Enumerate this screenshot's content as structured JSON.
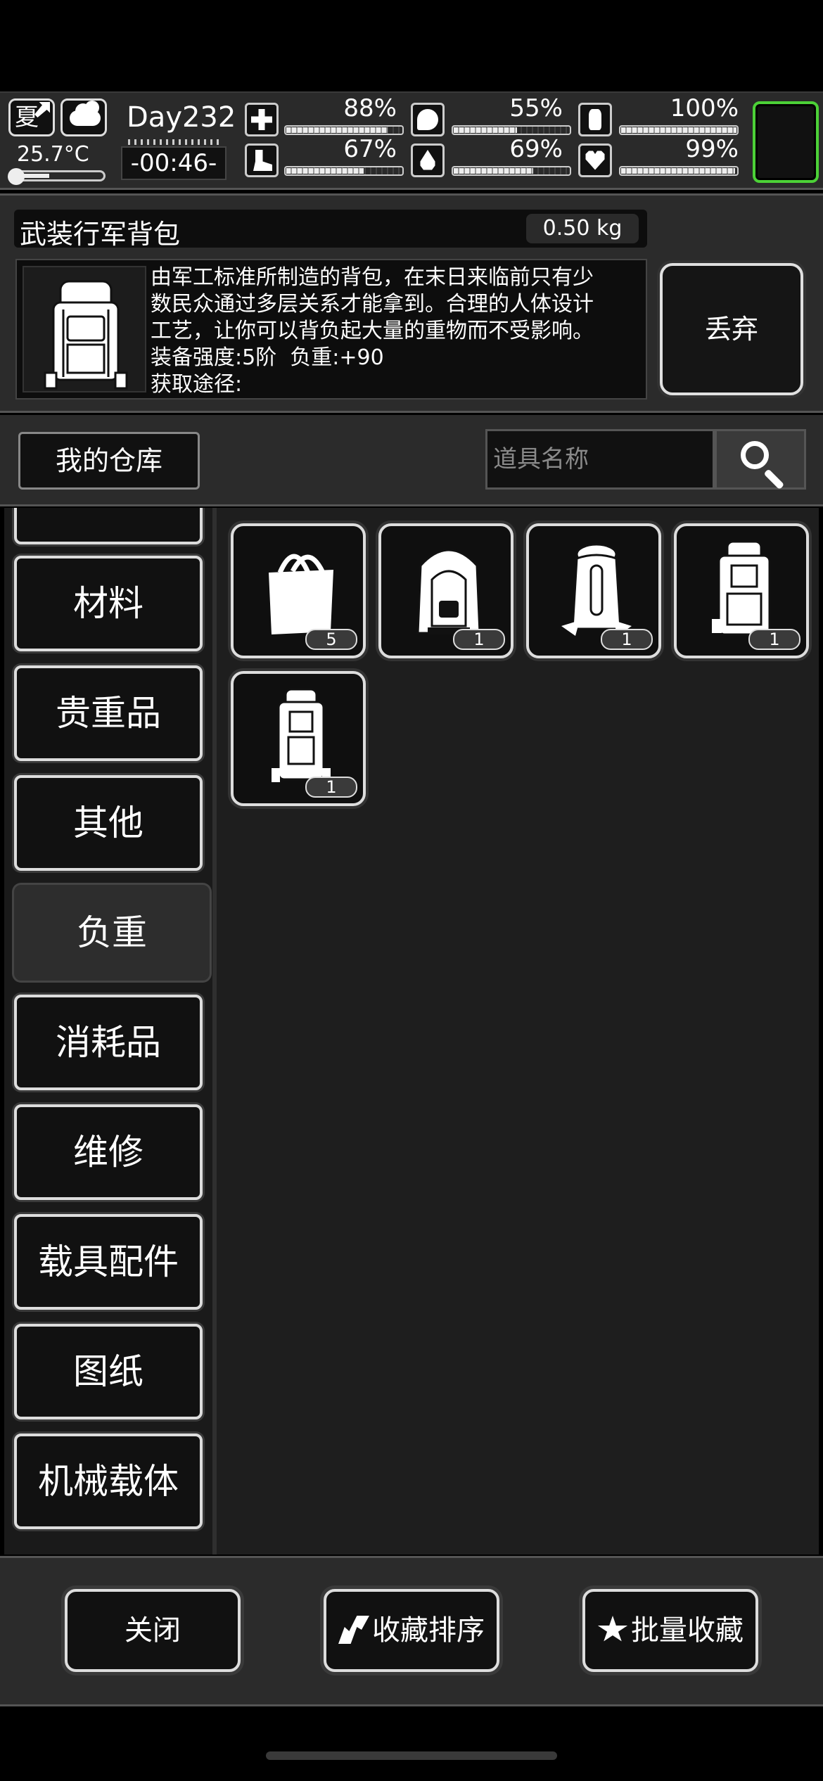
{
  "status": {
    "season": "夏",
    "temperature": "25.7°C",
    "temperature_level": 0.35,
    "day": "Day232",
    "clock": "-00:46-",
    "stats": [
      {
        "icon": "medkit-icon",
        "value": "88%",
        "level": 0.88
      },
      {
        "icon": "stomach-icon",
        "value": "55%",
        "level": 0.55
      },
      {
        "icon": "battery-icon",
        "value": "100%",
        "level": 1.0
      },
      {
        "icon": "foot-icon",
        "value": "67%",
        "level": 0.67
      },
      {
        "icon": "water-drop-icon",
        "value": "69%",
        "level": 0.69
      },
      {
        "icon": "heart-icon",
        "value": "99%",
        "level": 0.99
      }
    ],
    "accent_color": "#4cd137"
  },
  "detail": {
    "name": "武装行军背包",
    "weight": "0.50 kg",
    "description": "由军工标准所制造的背包，在末日来临前只有少\n数民众通过多层关系才能拿到。合理的人体设计\n工艺，让你可以背负起大量的重物而不受影响。\n装备强度:5阶  负重:+90\n获取途径:",
    "discard_label": "丢弃"
  },
  "warehouse": {
    "title": "我的仓库",
    "search_placeholder": "道具名称"
  },
  "categories": [
    "材料",
    "贵重品",
    "其他",
    "负重",
    "消耗品",
    "维修",
    "载具配件",
    "图纸",
    "机械载体"
  ],
  "active_category": "负重",
  "items": [
    {
      "icon": "tote-bag-icon",
      "count": "5"
    },
    {
      "icon": "backpack-icon",
      "count": "1"
    },
    {
      "icon": "hiking-backpack-icon",
      "count": "1"
    },
    {
      "icon": "military-backpack-icon",
      "count": "1"
    },
    {
      "icon": "armed-march-backpack-icon",
      "count": "1"
    }
  ],
  "bottom": {
    "close_label": "关闭",
    "sort_label": "收藏排序",
    "batch_label": "批量收藏"
  }
}
